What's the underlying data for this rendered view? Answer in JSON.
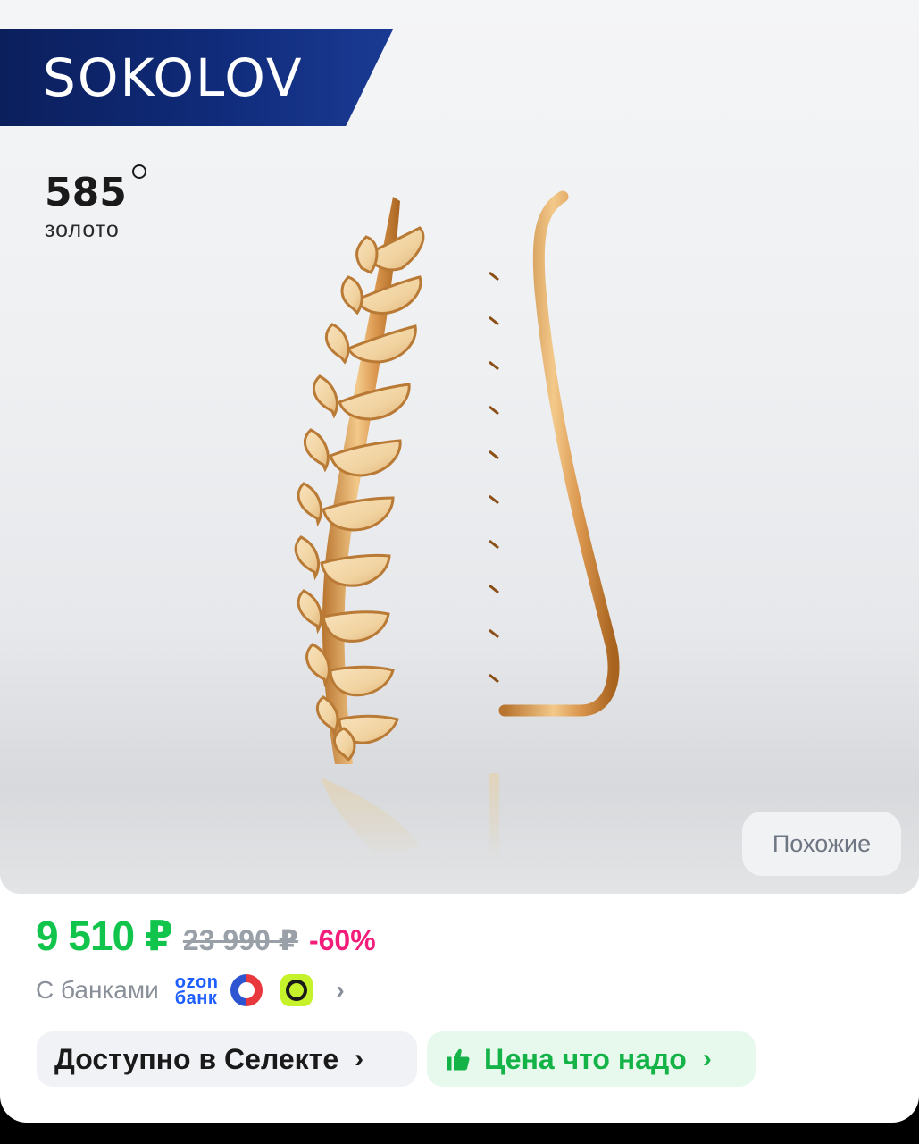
{
  "brand": {
    "name": "SOKOLOV"
  },
  "metal": {
    "purity": "585",
    "type": "золото"
  },
  "similar_button": {
    "label": "Похожие"
  },
  "price": {
    "current": "9 510 ₽",
    "old": "23 990 ₽",
    "discount": "-60%"
  },
  "banks": {
    "label": "С банками",
    "ozon_line1": "ozon",
    "ozon_line2": "банк",
    "icons": [
      "ozon-bank-icon",
      "bank-red-blue-icon",
      "bank-lime-icon"
    ]
  },
  "promos": {
    "select_label": "Доступно в Селекте",
    "price_label": "Цена что надо"
  },
  "colors": {
    "brand_blue": "#0b1f5c",
    "price_green": "#10c44c",
    "discount_pink": "#f21d7b",
    "muted": "#9aa0a8"
  }
}
